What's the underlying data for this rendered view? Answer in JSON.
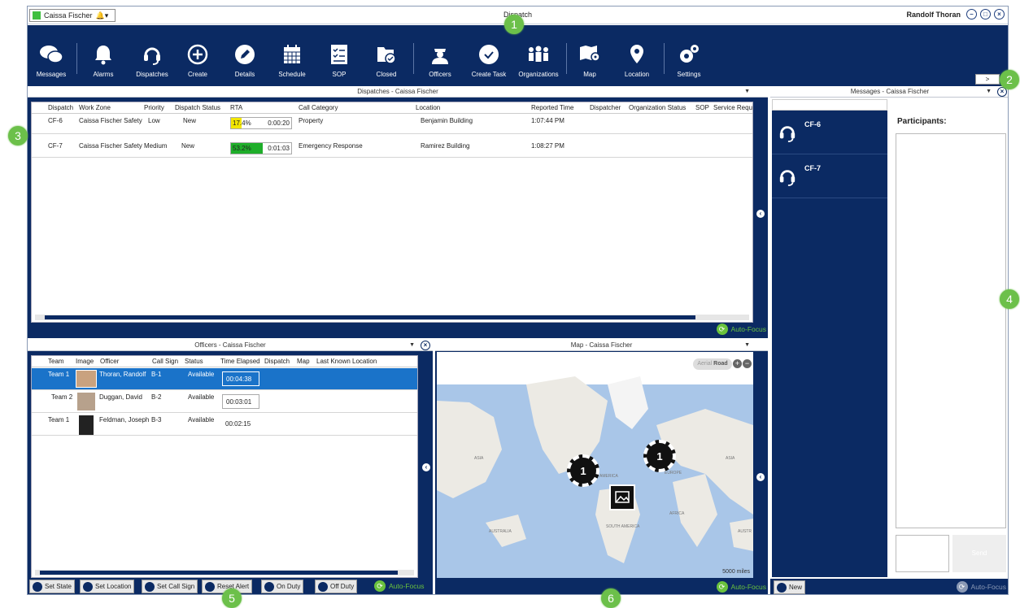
{
  "window": {
    "title": "Dispatch",
    "user_selector": "Caissa Fischer",
    "current_user": "Randolf Thoran"
  },
  "toolbar": {
    "items": [
      "Messages",
      "Alarms",
      "Dispatches",
      "Create",
      "Details",
      "Schedule",
      "SOP",
      "Closed",
      "Officers",
      "Create Task",
      "Organizations",
      "Map",
      "Location",
      "Settings"
    ],
    "expand_label": ">"
  },
  "dispatches": {
    "title": "Dispatches - Caissa Fischer",
    "columns": [
      "Dispatch",
      "Work Zone",
      "Priority",
      "Dispatch Status",
      "RTA",
      "Call Category",
      "Location",
      "Reported Time",
      "Dispatcher",
      "Organization Status",
      "SOP",
      "Service Requ"
    ],
    "rows": [
      {
        "dispatch": "CF-6",
        "zone": "Caissa Fischer Safety",
        "priority": "Low",
        "status": "New",
        "rta_pct": "17.4%",
        "rta_time": "0:00:20",
        "rta_fill": 0.174,
        "rta_color": "#f2e600",
        "category": "Property",
        "location": "Benjamin Building",
        "time": "1:07:44 PM"
      },
      {
        "dispatch": "CF-7",
        "zone": "Caissa Fischer Safety",
        "priority": "Medium",
        "status": "New",
        "rta_pct": "53.2%",
        "rta_time": "0:01:03",
        "rta_fill": 0.532,
        "rta_color": "#1fae2a",
        "category": "Emergency Response",
        "location": "Ramirez Building",
        "time": "1:08:27 PM"
      }
    ],
    "autofocus": "Auto-Focus"
  },
  "messages": {
    "title": "Messages - Caissa Fischer",
    "items": [
      "CF-6",
      "CF-7"
    ],
    "participants_label": "Participants:",
    "new_label": "New",
    "send_label": "Send",
    "autofocus": "Auto-Focus"
  },
  "officers": {
    "title": "Officers - Caissa Fischer",
    "columns": [
      "Team",
      "Image",
      "Officer",
      "Call Sign",
      "Status",
      "Time Elapsed",
      "Dispatch",
      "Map",
      "Last Known Location"
    ],
    "rows": [
      {
        "team": "Team 1",
        "officer": "Thoran, Randolf",
        "callsign": "B-1",
        "status": "Available",
        "elapsed": "00:04:38"
      },
      {
        "team": "Team 2",
        "officer": "Duggan, David",
        "callsign": "B-2",
        "status": "Available",
        "elapsed": "00:03:01"
      },
      {
        "team": "Team 1",
        "officer": "Feldman, Joseph",
        "callsign": "B-3",
        "status": "Available",
        "elapsed": "00:02:15"
      }
    ],
    "buttons": [
      "Set State",
      "Set Location",
      "Set Call Sign",
      "Reset Alert",
      "On Duty",
      "Off Duty"
    ],
    "autofocus": "Auto-Focus"
  },
  "map": {
    "title": "Map - Caissa Fischer",
    "mode_aerial": "Aerial",
    "mode_road": "Road",
    "scale": "5000 miles",
    "cluster_count": "1",
    "labels": [
      "ASIA",
      "AMERICA",
      "EUROPE",
      "ASIA",
      "AFRICA",
      "AUSTRALIA",
      "SOUTH AMERICA",
      "AUSTR"
    ],
    "autofocus": "Auto-Focus"
  },
  "callouts": [
    "1",
    "2",
    "3",
    "4",
    "5",
    "6"
  ]
}
